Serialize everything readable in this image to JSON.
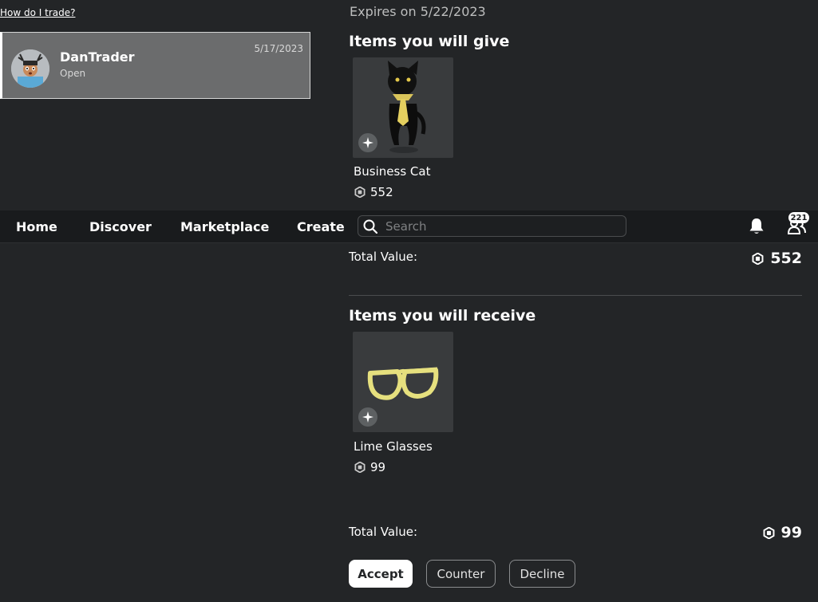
{
  "help": {
    "link": "How do I trade?"
  },
  "trade_list": [
    {
      "name": "DanTrader",
      "status": "Open",
      "date": "5/17/2023"
    }
  ],
  "trade": {
    "expires": "Expires on 5/22/2023",
    "give": {
      "title": "Items you will give",
      "items": [
        {
          "name": "Business Cat",
          "price": "552"
        }
      ],
      "total_label": "Total Value:",
      "total_value": "552"
    },
    "receive": {
      "title": "Items you will receive",
      "items": [
        {
          "name": "Lime Glasses",
          "price": "99"
        }
      ],
      "total_label": "Total Value:",
      "total_value": "99"
    }
  },
  "actions": {
    "accept": "Accept",
    "counter": "Counter",
    "decline": "Decline"
  },
  "nav": {
    "items": [
      "Home",
      "Discover",
      "Marketplace",
      "Create"
    ],
    "search_placeholder": "Search",
    "friends_count": "221"
  },
  "icons": {
    "currency": "robux-icon",
    "item_badge": "sparkle-icon",
    "search": "search-icon",
    "notifications": "bell-icon",
    "friends": "friends-icon"
  },
  "colors": {
    "background": "#232527",
    "navbar": "#191b1d",
    "selected_row": "#6b6c6d",
    "item_card": "#393b3d"
  }
}
